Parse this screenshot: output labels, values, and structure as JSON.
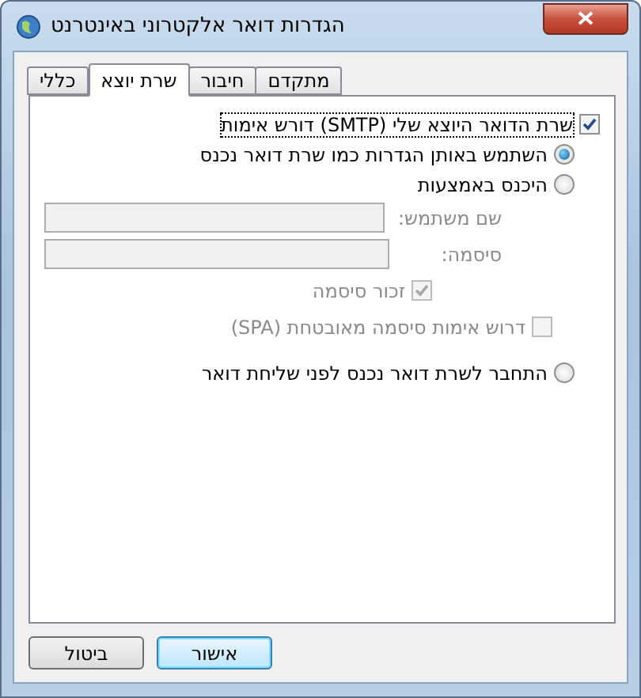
{
  "window": {
    "title": "הגדרות דואר אלקטרוני באינטרנט"
  },
  "tabs": [
    {
      "label": "מתקדם",
      "selected": false
    },
    {
      "label": "חיבור",
      "selected": false
    },
    {
      "label": "שרת יוצא",
      "selected": true
    },
    {
      "label": "כללי",
      "selected": false
    }
  ],
  "require_auth": {
    "label": "שרת הדואר היוצא שלי (SMTP) דורש אימות",
    "checked": true
  },
  "auth_options": [
    {
      "kind": "same",
      "label": "השתמש באותן הגדרות כמו שרת דואר נכנס",
      "selected": true
    },
    {
      "kind": "logon",
      "label": "היכנס באמצעות",
      "selected": false
    },
    {
      "kind": "pop_first",
      "label": "התחבר לשרת דואר נכנס לפני שליחת דואר",
      "selected": false
    }
  ],
  "credentials": {
    "disabled": true,
    "username_label": "שם משתמש:",
    "password_label": "סיסמה:",
    "remember_password": {
      "label": "זכור סיסמה",
      "checked": true
    },
    "spa": {
      "label": "דרוש אימות סיסמה מאובטחת (SPA)",
      "checked": false
    }
  },
  "buttons": [
    {
      "label": "אישור",
      "default": true
    },
    {
      "label": "ביטול",
      "default": false
    }
  ]
}
